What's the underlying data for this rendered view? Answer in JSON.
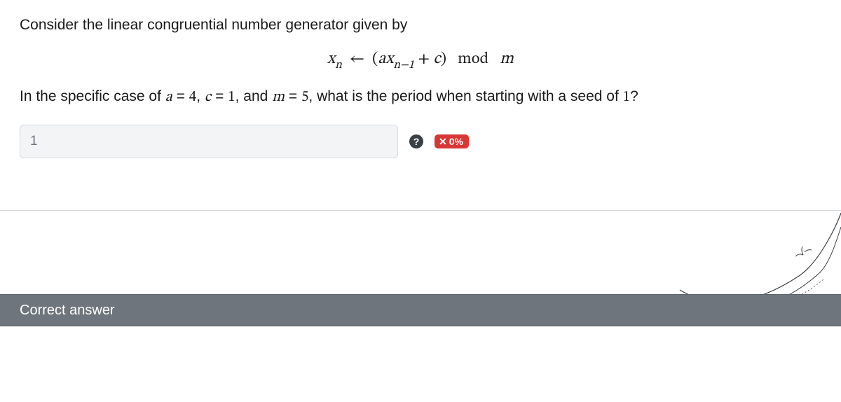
{
  "question": {
    "line1": "Consider the linear congruential number generator given by",
    "formula": "xₙ ← (axₙ₋₁ + c)  mod  m",
    "line2_pre": "In the specific case of ",
    "a_label": "a",
    "a_val": "4",
    "c_label": "c",
    "c_val": "1",
    "m_label": "m",
    "m_val": "5",
    "line2_mid": ", what is the period when starting with a seed of ",
    "seed": "1",
    "line2_end": "?"
  },
  "answer": {
    "value": "1"
  },
  "feedback": {
    "help": "?",
    "badge_x": "✕",
    "badge_pct": "0%"
  },
  "correct_header": "Correct answer"
}
